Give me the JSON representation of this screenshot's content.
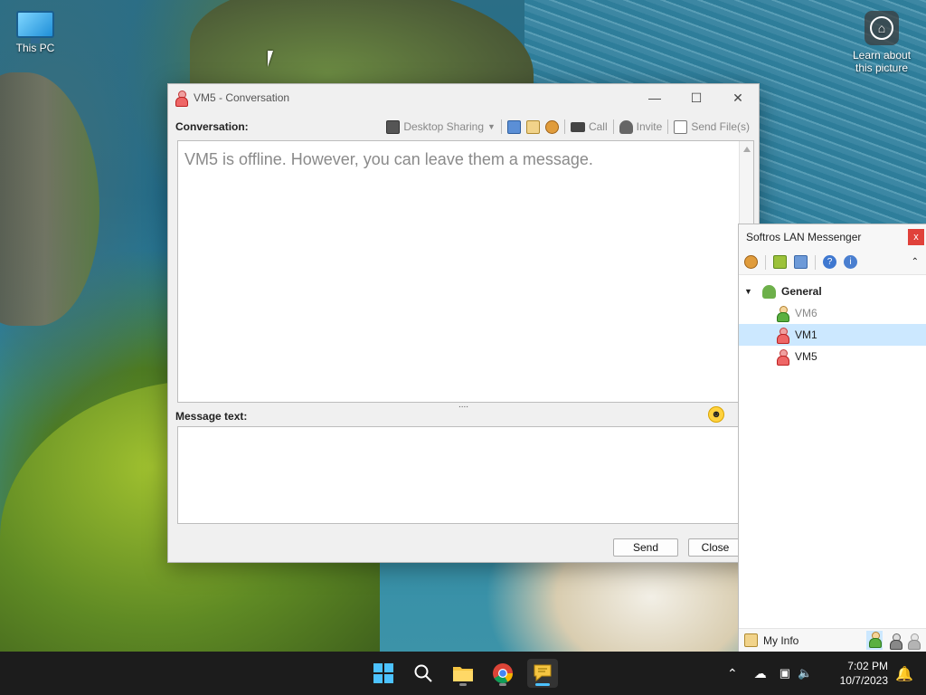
{
  "desktop": {
    "icons": {
      "this_pc": "This PC",
      "learn_picture": "Learn about this picture"
    }
  },
  "conversation": {
    "title": "VM5 - Conversation",
    "conversation_label": "Conversation:",
    "toolbar": {
      "desktop_sharing": "Desktop Sharing",
      "call": "Call",
      "invite": "Invite",
      "send_files": "Send File(s)"
    },
    "offline_message": "VM5 is offline. However, you can leave them a message.",
    "splitter": "....",
    "message_label": "Message text:",
    "send_button": "Send",
    "close_button": "Close"
  },
  "messenger": {
    "title": "Softros LAN Messenger",
    "close": "x",
    "group": "General",
    "users": [
      {
        "name": "VM6",
        "status": "online"
      },
      {
        "name": "VM1",
        "status": "offline"
      },
      {
        "name": "VM5",
        "status": "offline"
      }
    ],
    "my_info": "My Info"
  },
  "taskbar": {
    "time": "7:02 PM",
    "date": "10/7/2023"
  },
  "colors": {
    "accent": "#4cc2ff",
    "selection": "#cce8ff",
    "taskbar": "#1c1c1c"
  }
}
